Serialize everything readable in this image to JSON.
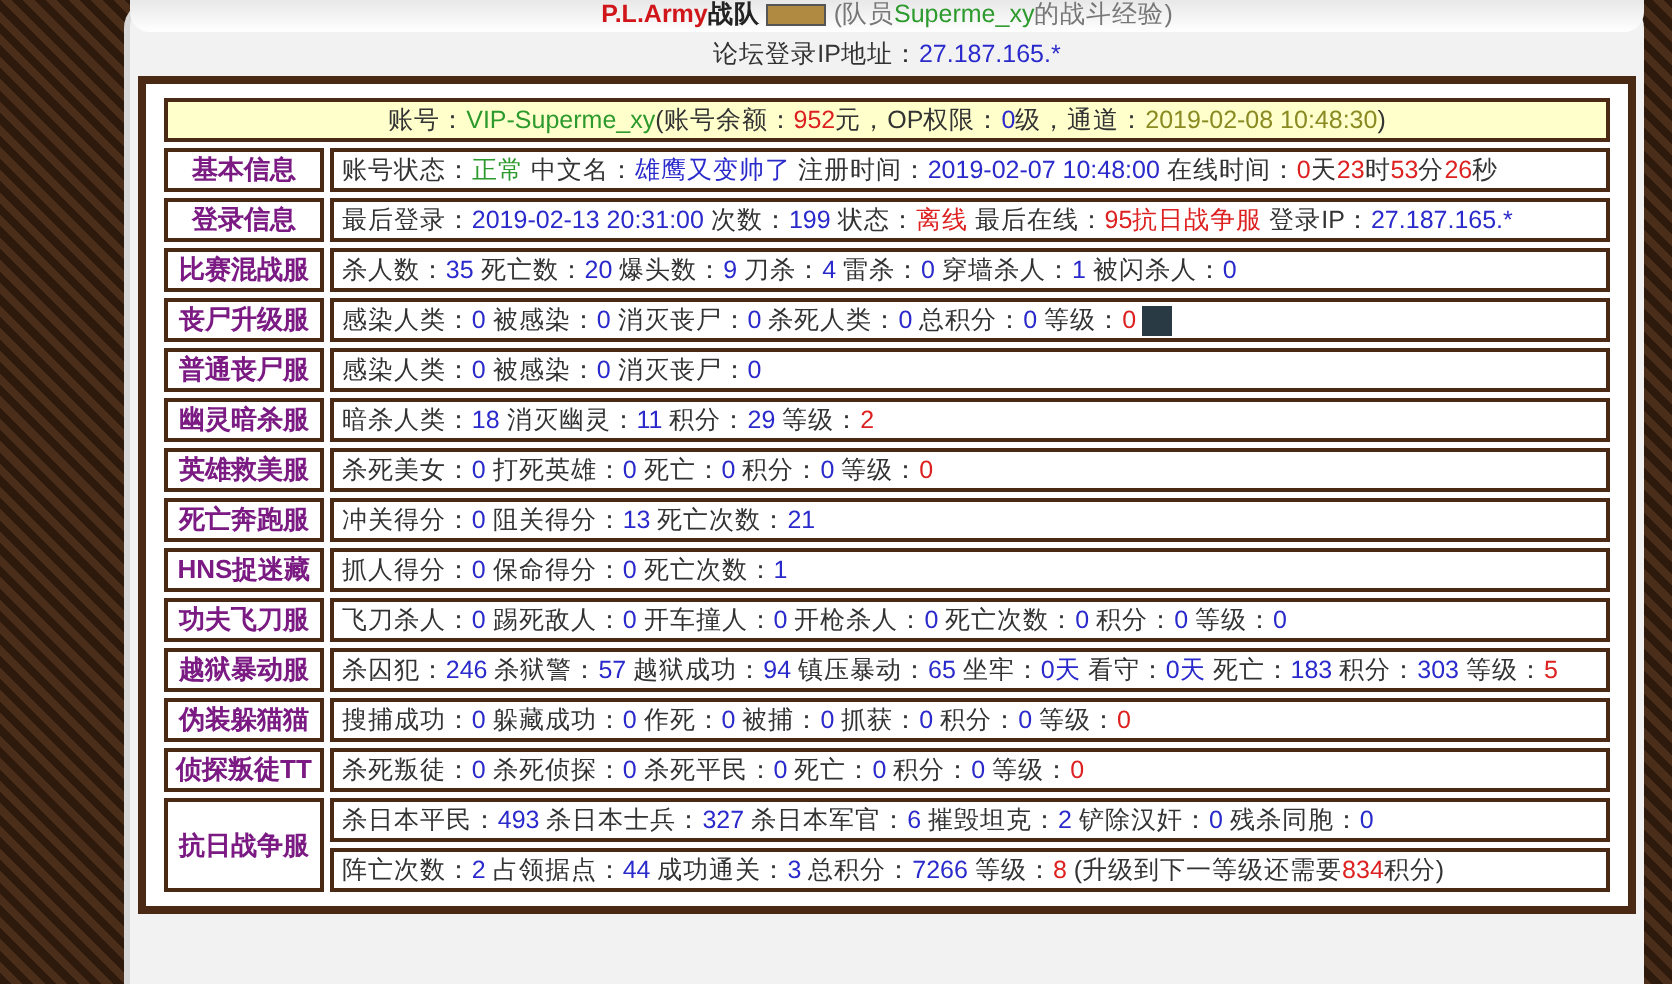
{
  "title": {
    "team": "P.L.Army",
    "suffix": "战队",
    "member_note": [
      {
        "text": "(队员",
        "kind": "gray"
      },
      {
        "text": "Superme_xy",
        "kind": "green"
      },
      {
        "text": "的战斗经验)",
        "kind": "gray"
      }
    ]
  },
  "forum_ip": [
    {
      "text": "论坛登录IP地址：",
      "kind": "plain"
    },
    {
      "text": "27.187.165.*",
      "kind": "value"
    }
  ],
  "account_header": [
    {
      "text": "账号：",
      "kind": "plain"
    },
    {
      "text": "VIP-Superme_xy",
      "kind": "green"
    },
    {
      "text": "(账号余额：",
      "kind": "plain"
    },
    {
      "text": "952",
      "kind": "red"
    },
    {
      "text": "元，OP权限：",
      "kind": "plain"
    },
    {
      "text": "0",
      "kind": "value"
    },
    {
      "text": "级，通道：",
      "kind": "plain"
    },
    {
      "text": "2019-02-08 10:48:30",
      "kind": "olive"
    },
    {
      "text": ")",
      "kind": "plain"
    }
  ],
  "rows": [
    {
      "label": "基本信息",
      "lines": [
        {
          "segments": [
            {
              "text": "账号状态：",
              "kind": "plain"
            },
            {
              "text": "正常",
              "kind": "green"
            },
            {
              "text": " 中文名：",
              "kind": "plain"
            },
            {
              "text": "雄鹰又变帅了",
              "kind": "value"
            },
            {
              "text": " 注册时间：",
              "kind": "plain"
            },
            {
              "text": "2019-02-07 10:48:00",
              "kind": "value"
            },
            {
              "text": " 在线时间：",
              "kind": "plain"
            },
            {
              "text": "0",
              "kind": "red"
            },
            {
              "text": "天",
              "kind": "plain"
            },
            {
              "text": "23",
              "kind": "red"
            },
            {
              "text": "时",
              "kind": "plain"
            },
            {
              "text": "53",
              "kind": "red"
            },
            {
              "text": "分",
              "kind": "plain"
            },
            {
              "text": "26",
              "kind": "red"
            },
            {
              "text": "秒",
              "kind": "plain"
            }
          ]
        }
      ]
    },
    {
      "label": "登录信息",
      "lines": [
        {
          "segments": [
            {
              "text": "最后登录：",
              "kind": "plain"
            },
            {
              "text": "2019-02-13 20:31:00",
              "kind": "value"
            },
            {
              "text": " 次数：",
              "kind": "plain"
            },
            {
              "text": "199",
              "kind": "value"
            },
            {
              "text": " 状态：",
              "kind": "plain"
            },
            {
              "text": "离线",
              "kind": "red"
            },
            {
              "text": " 最后在线：",
              "kind": "plain"
            },
            {
              "text": "95抗日战争服",
              "kind": "red"
            },
            {
              "text": " 登录IP：",
              "kind": "plain"
            },
            {
              "text": "27.187.165.*",
              "kind": "value"
            }
          ]
        }
      ]
    },
    {
      "label": "比赛混战服",
      "lines": [
        {
          "segments": [
            {
              "text": "杀人数：",
              "kind": "plain"
            },
            {
              "text": "35",
              "kind": "value"
            },
            {
              "text": " 死亡数：",
              "kind": "plain"
            },
            {
              "text": "20",
              "kind": "value"
            },
            {
              "text": " 爆头数：",
              "kind": "plain"
            },
            {
              "text": "9",
              "kind": "value"
            },
            {
              "text": " 刀杀：",
              "kind": "plain"
            },
            {
              "text": "4",
              "kind": "value"
            },
            {
              "text": " 雷杀：",
              "kind": "plain"
            },
            {
              "text": "0",
              "kind": "value"
            },
            {
              "text": " 穿墙杀人：",
              "kind": "plain"
            },
            {
              "text": "1",
              "kind": "value"
            },
            {
              "text": " 被闪杀人：",
              "kind": "plain"
            },
            {
              "text": "0",
              "kind": "value"
            }
          ]
        }
      ]
    },
    {
      "label": "丧尸升级服",
      "lines": [
        {
          "segments": [
            {
              "text": "感染人类：",
              "kind": "plain"
            },
            {
              "text": "0",
              "kind": "value"
            },
            {
              "text": " 被感染：",
              "kind": "plain"
            },
            {
              "text": "0",
              "kind": "value"
            },
            {
              "text": " 消灭丧尸：",
              "kind": "plain"
            },
            {
              "text": "0",
              "kind": "value"
            },
            {
              "text": " 杀死人类：",
              "kind": "plain"
            },
            {
              "text": "0",
              "kind": "value"
            },
            {
              "text": " 总积分：",
              "kind": "plain"
            },
            {
              "text": "0",
              "kind": "value"
            },
            {
              "text": " 等级：",
              "kind": "plain"
            },
            {
              "text": "0",
              "kind": "red"
            }
          ],
          "rank_picture": true
        }
      ]
    },
    {
      "label": "普通丧尸服",
      "lines": [
        {
          "segments": [
            {
              "text": "感染人类：",
              "kind": "plain"
            },
            {
              "text": "0",
              "kind": "value"
            },
            {
              "text": " 被感染：",
              "kind": "plain"
            },
            {
              "text": "0",
              "kind": "value"
            },
            {
              "text": " 消灭丧尸：",
              "kind": "plain"
            },
            {
              "text": "0",
              "kind": "value"
            }
          ]
        }
      ]
    },
    {
      "label": "幽灵暗杀服",
      "lines": [
        {
          "segments": [
            {
              "text": "暗杀人类：",
              "kind": "plain"
            },
            {
              "text": "18",
              "kind": "value"
            },
            {
              "text": " 消灭幽灵：",
              "kind": "plain"
            },
            {
              "text": "11",
              "kind": "value"
            },
            {
              "text": " 积分：",
              "kind": "plain"
            },
            {
              "text": "29",
              "kind": "value"
            },
            {
              "text": " 等级：",
              "kind": "plain"
            },
            {
              "text": "2",
              "kind": "red"
            }
          ]
        }
      ]
    },
    {
      "label": "英雄救美服",
      "lines": [
        {
          "segments": [
            {
              "text": "杀死美女：",
              "kind": "plain"
            },
            {
              "text": "0",
              "kind": "value"
            },
            {
              "text": " 打死英雄：",
              "kind": "plain"
            },
            {
              "text": "0",
              "kind": "value"
            },
            {
              "text": " 死亡：",
              "kind": "plain"
            },
            {
              "text": "0",
              "kind": "value"
            },
            {
              "text": " 积分：",
              "kind": "plain"
            },
            {
              "text": "0",
              "kind": "value"
            },
            {
              "text": " 等级：",
              "kind": "plain"
            },
            {
              "text": "0",
              "kind": "red"
            }
          ]
        }
      ]
    },
    {
      "label": "死亡奔跑服",
      "lines": [
        {
          "segments": [
            {
              "text": "冲关得分：",
              "kind": "plain"
            },
            {
              "text": "0",
              "kind": "value"
            },
            {
              "text": " 阻关得分：",
              "kind": "plain"
            },
            {
              "text": "13",
              "kind": "value"
            },
            {
              "text": " 死亡次数：",
              "kind": "plain"
            },
            {
              "text": "21",
              "kind": "value"
            }
          ]
        }
      ]
    },
    {
      "label": "HNS捉迷藏",
      "lines": [
        {
          "segments": [
            {
              "text": "抓人得分：",
              "kind": "plain"
            },
            {
              "text": "0",
              "kind": "value"
            },
            {
              "text": " 保命得分：",
              "kind": "plain"
            },
            {
              "text": "0",
              "kind": "value"
            },
            {
              "text": " 死亡次数：",
              "kind": "plain"
            },
            {
              "text": "1",
              "kind": "value"
            }
          ]
        }
      ]
    },
    {
      "label": "功夫飞刀服",
      "lines": [
        {
          "segments": [
            {
              "text": "飞刀杀人：",
              "kind": "plain"
            },
            {
              "text": "0",
              "kind": "value"
            },
            {
              "text": " 踢死敌人：",
              "kind": "plain"
            },
            {
              "text": "0",
              "kind": "value"
            },
            {
              "text": " 开车撞人：",
              "kind": "plain"
            },
            {
              "text": "0",
              "kind": "value"
            },
            {
              "text": " 开枪杀人：",
              "kind": "plain"
            },
            {
              "text": "0",
              "kind": "value"
            },
            {
              "text": " 死亡次数：",
              "kind": "plain"
            },
            {
              "text": "0",
              "kind": "value"
            },
            {
              "text": " 积分：",
              "kind": "plain"
            },
            {
              "text": "0",
              "kind": "value"
            },
            {
              "text": " 等级：",
              "kind": "plain"
            },
            {
              "text": "0",
              "kind": "value"
            }
          ]
        }
      ]
    },
    {
      "label": "越狱暴动服",
      "lines": [
        {
          "segments": [
            {
              "text": "杀囚犯：",
              "kind": "plain"
            },
            {
              "text": "246",
              "kind": "value"
            },
            {
              "text": " 杀狱警：",
              "kind": "plain"
            },
            {
              "text": "57",
              "kind": "value"
            },
            {
              "text": " 越狱成功：",
              "kind": "plain"
            },
            {
              "text": "94",
              "kind": "value"
            },
            {
              "text": " 镇压暴动：",
              "kind": "plain"
            },
            {
              "text": "65",
              "kind": "value"
            },
            {
              "text": " 坐牢：",
              "kind": "plain"
            },
            {
              "text": "0天",
              "kind": "value"
            },
            {
              "text": " 看守：",
              "kind": "plain"
            },
            {
              "text": "0天",
              "kind": "value"
            },
            {
              "text": " 死亡：",
              "kind": "plain"
            },
            {
              "text": "183",
              "kind": "value"
            },
            {
              "text": " 积分：",
              "kind": "plain"
            },
            {
              "text": "303",
              "kind": "value"
            },
            {
              "text": " 等级：",
              "kind": "plain"
            },
            {
              "text": "5",
              "kind": "red"
            }
          ]
        }
      ]
    },
    {
      "label": "伪装躲猫猫",
      "lines": [
        {
          "segments": [
            {
              "text": "搜捕成功：",
              "kind": "plain"
            },
            {
              "text": "0",
              "kind": "value"
            },
            {
              "text": " 躲藏成功：",
              "kind": "plain"
            },
            {
              "text": "0",
              "kind": "value"
            },
            {
              "text": " 作死：",
              "kind": "plain"
            },
            {
              "text": "0",
              "kind": "value"
            },
            {
              "text": " 被捕：",
              "kind": "plain"
            },
            {
              "text": "0",
              "kind": "value"
            },
            {
              "text": " 抓获：",
              "kind": "plain"
            },
            {
              "text": "0",
              "kind": "value"
            },
            {
              "text": " 积分：",
              "kind": "plain"
            },
            {
              "text": "0",
              "kind": "value"
            },
            {
              "text": " 等级：",
              "kind": "plain"
            },
            {
              "text": "0",
              "kind": "red"
            }
          ]
        }
      ]
    },
    {
      "label": "侦探叛徒TT",
      "lines": [
        {
          "segments": [
            {
              "text": "杀死叛徒：",
              "kind": "plain"
            },
            {
              "text": "0",
              "kind": "value"
            },
            {
              "text": " 杀死侦探：",
              "kind": "plain"
            },
            {
              "text": "0",
              "kind": "value"
            },
            {
              "text": " 杀死平民：",
              "kind": "plain"
            },
            {
              "text": "0",
              "kind": "value"
            },
            {
              "text": " 死亡：",
              "kind": "plain"
            },
            {
              "text": "0",
              "kind": "value"
            },
            {
              "text": " 积分：",
              "kind": "plain"
            },
            {
              "text": "0",
              "kind": "value"
            },
            {
              "text": " 等级：",
              "kind": "plain"
            },
            {
              "text": "0",
              "kind": "red"
            }
          ]
        }
      ]
    },
    {
      "label": "抗日战争服",
      "lines": [
        {
          "segments": [
            {
              "text": "杀日本平民：",
              "kind": "plain"
            },
            {
              "text": "493",
              "kind": "value"
            },
            {
              "text": " 杀日本士兵：",
              "kind": "plain"
            },
            {
              "text": "327",
              "kind": "value"
            },
            {
              "text": " 杀日本军官：",
              "kind": "plain"
            },
            {
              "text": "6",
              "kind": "value"
            },
            {
              "text": " 摧毁坦克：",
              "kind": "plain"
            },
            {
              "text": "2",
              "kind": "value"
            },
            {
              "text": " 铲除汉奸：",
              "kind": "plain"
            },
            {
              "text": "0",
              "kind": "value"
            },
            {
              "text": " 残杀同胞：",
              "kind": "plain"
            },
            {
              "text": "0",
              "kind": "value"
            }
          ]
        },
        {
          "segments": [
            {
              "text": "阵亡次数：",
              "kind": "plain"
            },
            {
              "text": "2",
              "kind": "value"
            },
            {
              "text": " 占领据点：",
              "kind": "plain"
            },
            {
              "text": "44",
              "kind": "value"
            },
            {
              "text": " 成功通关：",
              "kind": "plain"
            },
            {
              "text": "3",
              "kind": "value"
            },
            {
              "text": " 总积分：",
              "kind": "plain"
            },
            {
              "text": "7266",
              "kind": "value"
            },
            {
              "text": " 等级：",
              "kind": "plain"
            },
            {
              "text": "8",
              "kind": "red"
            },
            {
              "text": " (升级到下一等级还需要",
              "kind": "plain"
            },
            {
              "text": "834",
              "kind": "red"
            },
            {
              "text": "积分)",
              "kind": "plain"
            }
          ]
        }
      ]
    }
  ]
}
